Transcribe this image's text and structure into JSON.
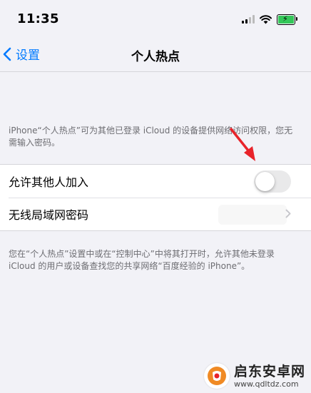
{
  "status_bar": {
    "time": "11:35"
  },
  "nav": {
    "back_label": "设置",
    "title": "个人热点"
  },
  "info_top": "iPhone“个人热点”可为其他已登录 iCloud 的设备提供网络访问权限，您无需输入密码。",
  "settings": {
    "allow_others": {
      "label": "允许其他人加入",
      "enabled": false
    },
    "wifi_password": {
      "label": "无线局域网密码"
    }
  },
  "info_bottom": "您在“个人热点”设置中或在“控制中心”中将其打开时，允许其他未登录 iCloud 的用户或设备查找您的共享网络“百度经验的 iPhone”。",
  "watermark": {
    "name": "启东安卓网",
    "url": "www.qdltdz.com"
  },
  "colors": {
    "accent": "#007aff",
    "annotation_arrow": "#e8232a",
    "battery": "#34c759"
  }
}
